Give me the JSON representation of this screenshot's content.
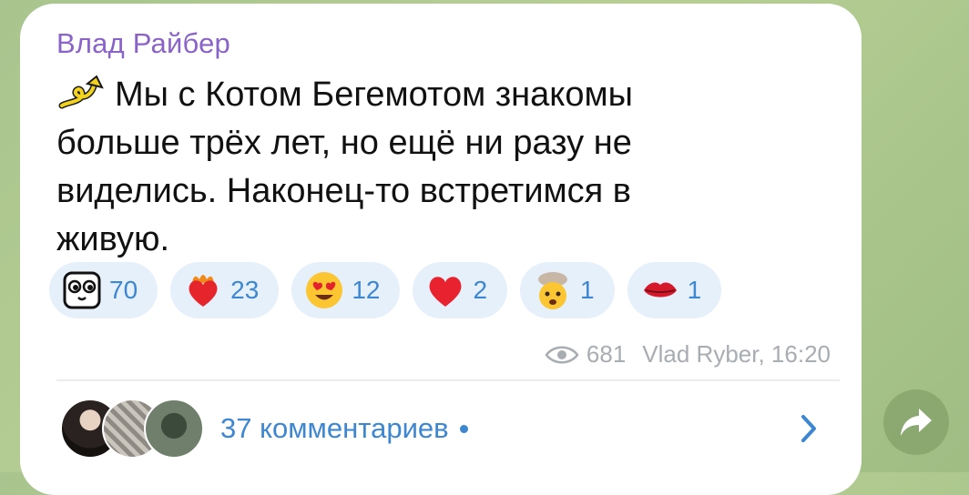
{
  "post": {
    "author": "Влад Райбер",
    "text": "Мы с Котом Бегемотом знакомы больше трёх лет, но ещё ни разу не виделись. Наконец-то встретимся в живую.",
    "reactions": [
      {
        "emoji": "cartoon-face-sticker",
        "count": "70"
      },
      {
        "emoji": "heart-on-fire",
        "count": "23"
      },
      {
        "emoji": "heart-eyes",
        "count": "12"
      },
      {
        "emoji": "red-heart",
        "count": "2"
      },
      {
        "emoji": "exploding-head",
        "count": "1"
      },
      {
        "emoji": "kiss-lips",
        "count": "1"
      }
    ],
    "views": "681",
    "signature": "Vlad Ryber, 16:20",
    "comments_label": "37 комментариев"
  },
  "colors": {
    "author": "#8a63c9",
    "link": "#3d86d1",
    "reaction_bg": "#e6f0fb"
  }
}
